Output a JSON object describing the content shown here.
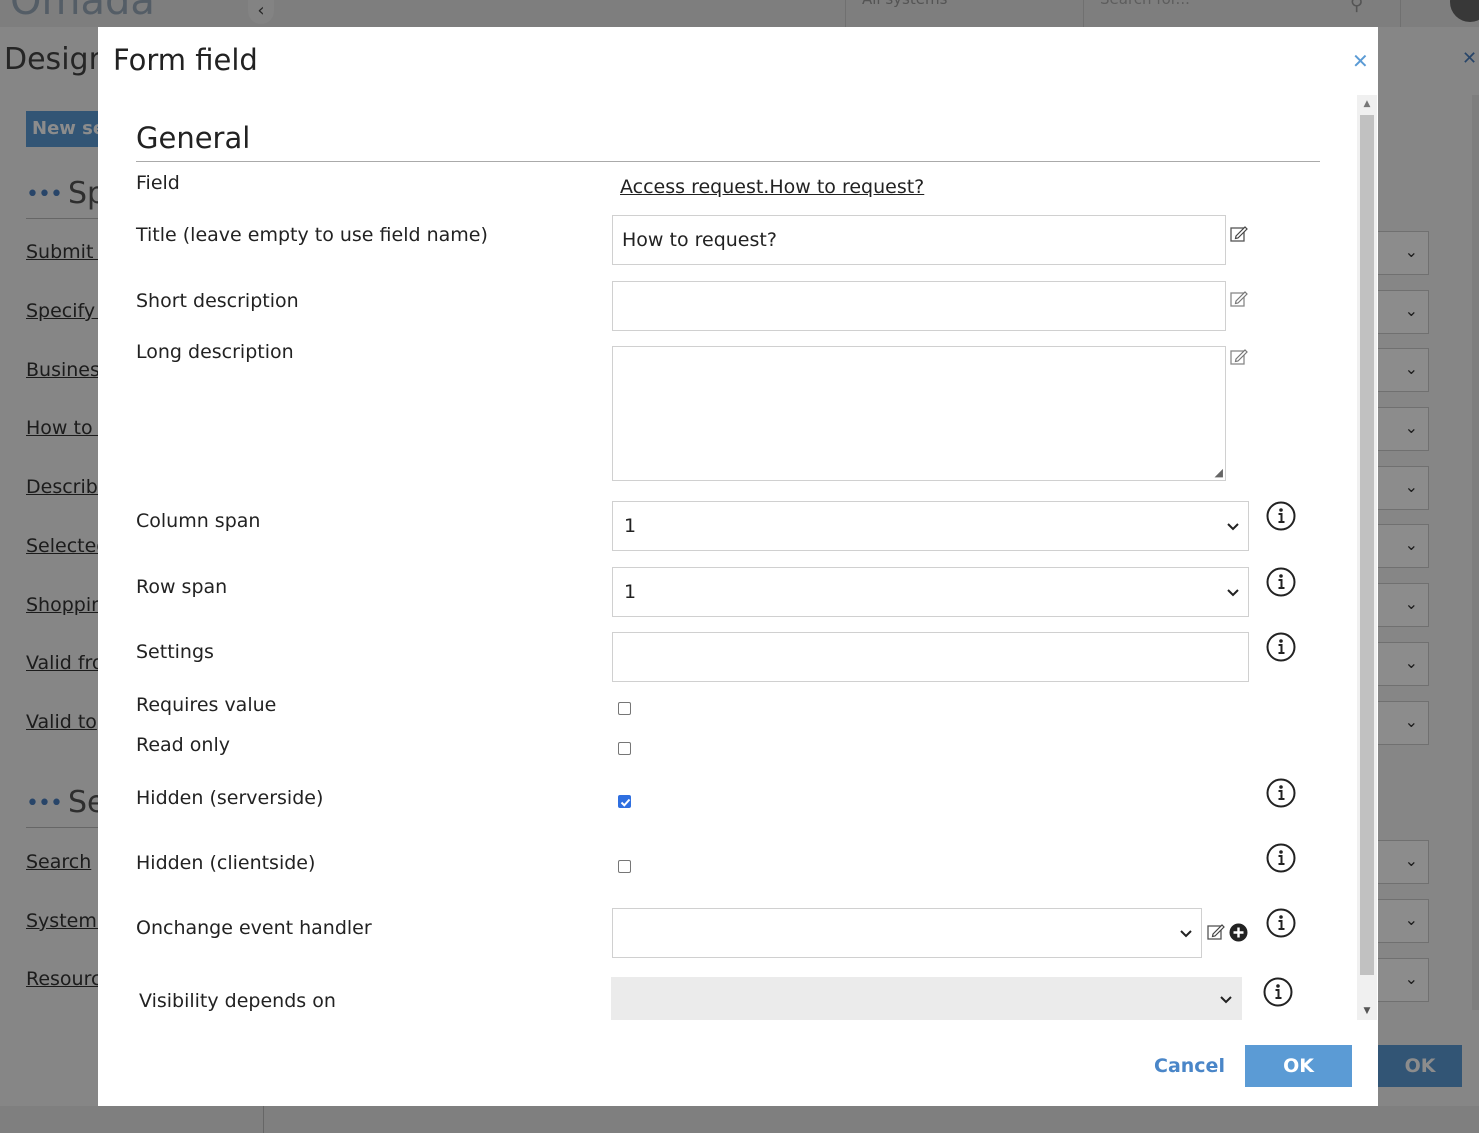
{
  "background": {
    "logo": "Omada",
    "system_select": "All systems",
    "search_placeholder": "Search for...",
    "page_title": "Design",
    "new_button": "New se",
    "section1": "Sp",
    "section2": "Se",
    "links": [
      "Submit r",
      "Specify a",
      "Business",
      "How to r",
      "Describe",
      "Selected",
      "Shoppin",
      "Valid fro",
      "Valid to",
      "Search",
      "System t",
      "Resourc"
    ],
    "ok_label": "OK"
  },
  "modal": {
    "title": "Form field",
    "section_heading": "General",
    "field": {
      "label": "Field",
      "value": "Access request.How to request?"
    },
    "title_field": {
      "label": "Title (leave empty to use field name)",
      "value": "How to request?"
    },
    "short_description": {
      "label": "Short description",
      "value": ""
    },
    "long_description": {
      "label": "Long description",
      "value": ""
    },
    "column_span": {
      "label": "Column span",
      "value": "1"
    },
    "row_span": {
      "label": "Row span",
      "value": "1"
    },
    "settings": {
      "label": "Settings",
      "value": ""
    },
    "requires_value": {
      "label": "Requires value",
      "checked": false
    },
    "read_only": {
      "label": "Read only",
      "checked": false
    },
    "hidden_serverside": {
      "label": "Hidden (serverside)",
      "checked": true
    },
    "hidden_clientside": {
      "label": "Hidden (clientside)",
      "checked": false
    },
    "onchange_handler": {
      "label": "Onchange event handler",
      "value": ""
    },
    "visibility_depends_on": {
      "label": "Visibility depends on",
      "value": ""
    },
    "cancel_label": "Cancel",
    "ok_label": "OK"
  },
  "colors": {
    "accent": "#5b9bd5",
    "link": "#4a86c8",
    "checkbox": "#2f6fe0"
  }
}
